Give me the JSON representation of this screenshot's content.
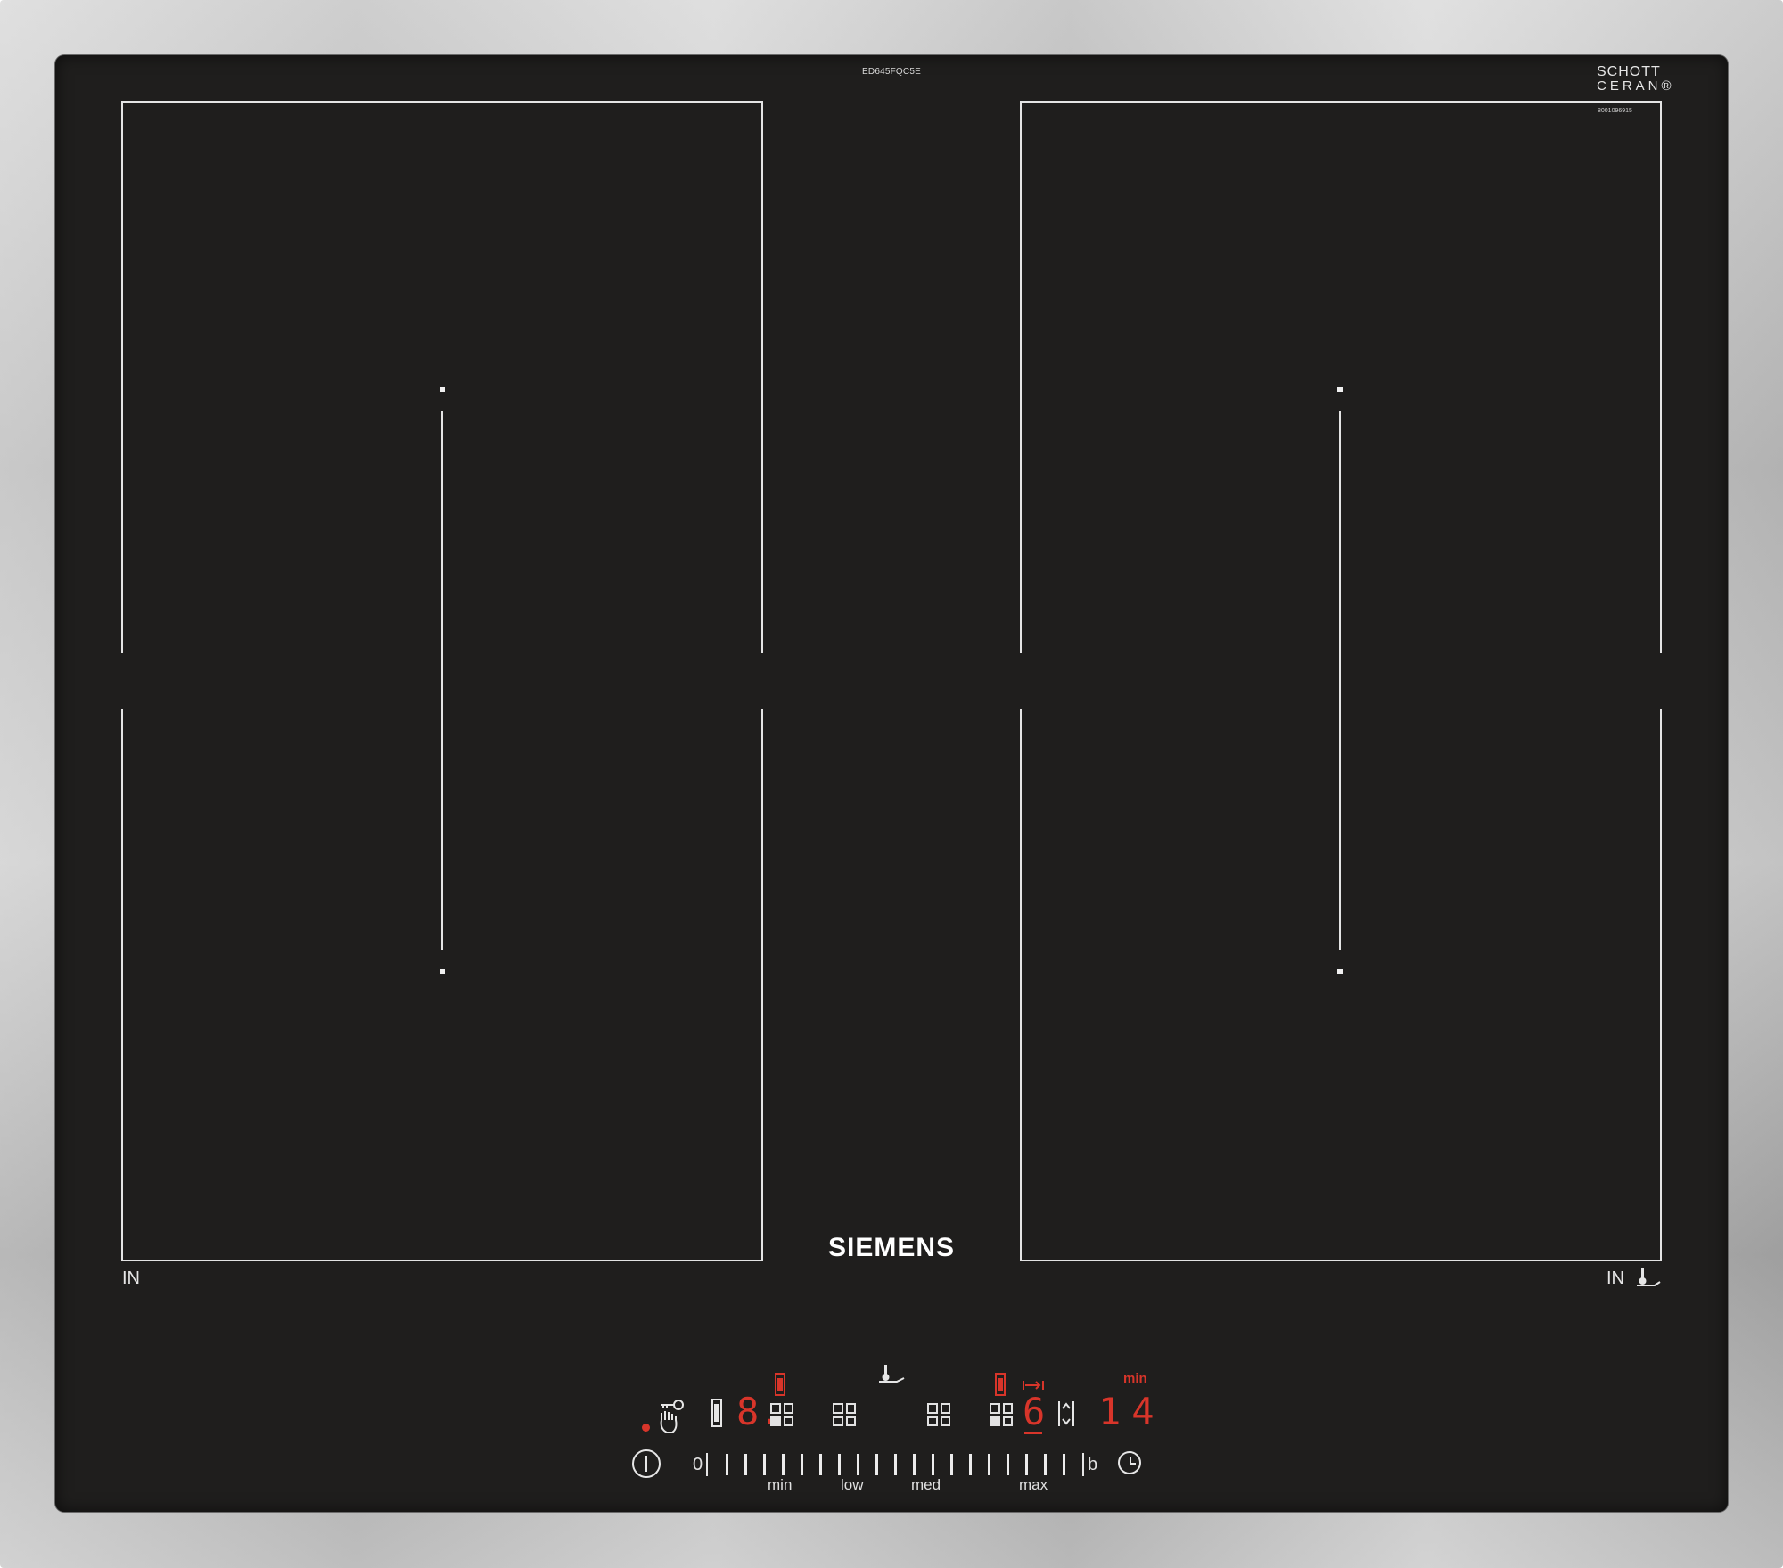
{
  "hob": {
    "model_number": "ED645FQC5E",
    "glass_brand_line1": "SCHOTT",
    "glass_brand_line2": "CERAN®",
    "serial_number": "8001096915",
    "brand": "SIEMENS",
    "zone_label_left": "IN",
    "zone_label_right": "IN"
  },
  "control_panel": {
    "left_zone_display": "8.",
    "right_zone_display": "6",
    "timer_unit": "min",
    "timer_value": "14",
    "slider_start": "0",
    "slider_end": "b",
    "slider_labels": {
      "min": "min",
      "low": "low",
      "med": "med",
      "max": "max"
    },
    "indicator_color": "#d8352a"
  },
  "icons": [
    "power-icon",
    "child-lock-icon",
    "wipe-protection-icon",
    "frying-sensor-icon",
    "zone-select-icon",
    "timer-icon",
    "flex-zone-icon"
  ]
}
